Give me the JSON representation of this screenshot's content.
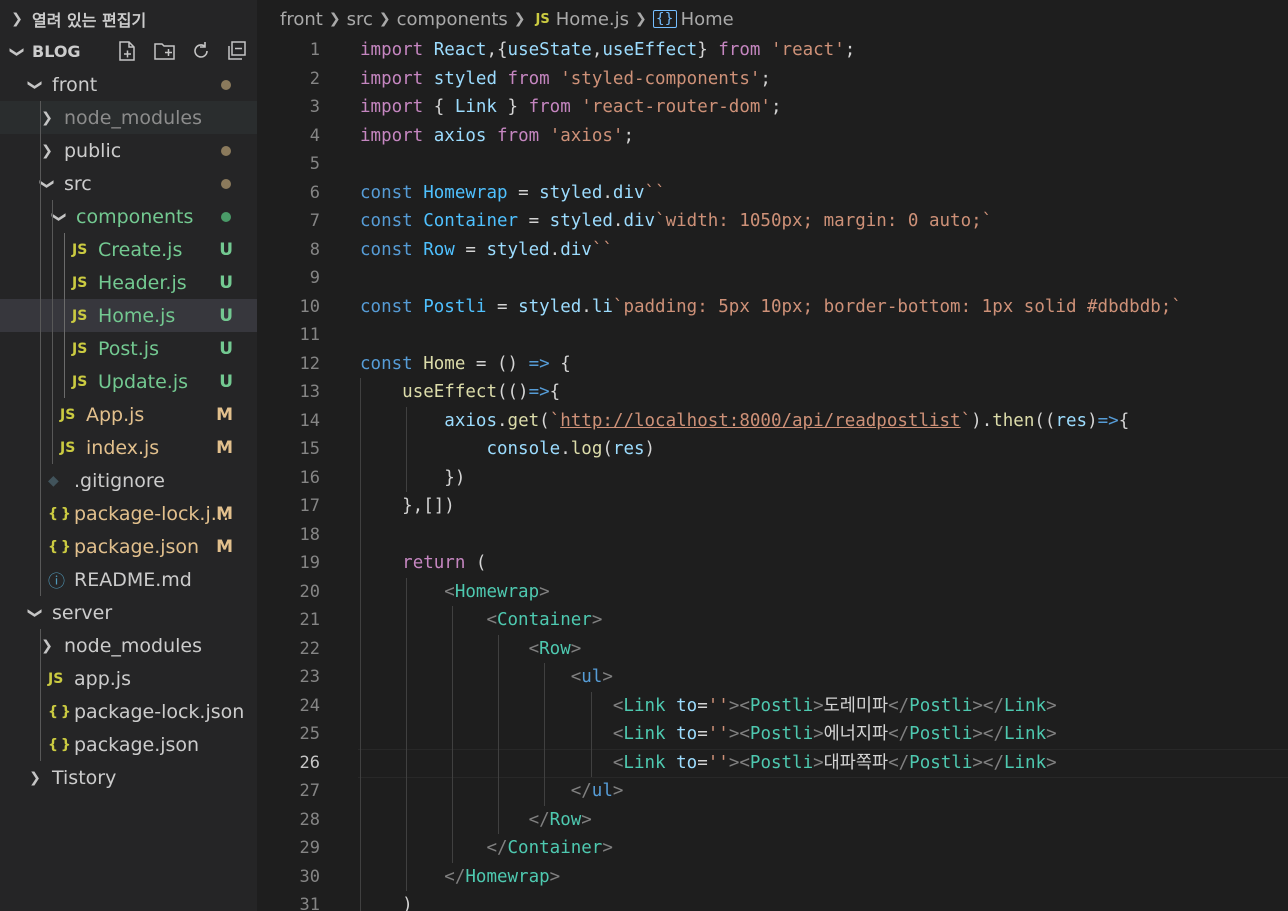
{
  "explorer": {
    "open_editors_label": "열려 있는 편집기",
    "project": "BLOG",
    "toolbar_icons": [
      "new-file-icon",
      "new-folder-icon",
      "refresh-icon",
      "collapse-all-icon"
    ],
    "items": [
      {
        "label": "front",
        "kind": "folder",
        "expanded": true,
        "indent": 1,
        "status": "dot"
      },
      {
        "label": "node_modules",
        "kind": "folder",
        "expanded": false,
        "indent": 2,
        "status": "",
        "dim": true
      },
      {
        "label": "public",
        "kind": "folder",
        "expanded": false,
        "indent": 2,
        "status": "dot"
      },
      {
        "label": "src",
        "kind": "folder",
        "expanded": true,
        "indent": 2,
        "status": "dot"
      },
      {
        "label": "components",
        "kind": "folder",
        "expanded": true,
        "indent": 3,
        "status": "dot-green",
        "color": "green"
      },
      {
        "label": "Create.js",
        "kind": "js",
        "indent": 4,
        "status": "U",
        "color": "green"
      },
      {
        "label": "Header.js",
        "kind": "js",
        "indent": 4,
        "status": "U",
        "color": "green"
      },
      {
        "label": "Home.js",
        "kind": "js",
        "indent": 4,
        "status": "U",
        "color": "green",
        "selected": true
      },
      {
        "label": "Post.js",
        "kind": "js",
        "indent": 4,
        "status": "U",
        "color": "green"
      },
      {
        "label": "Update.js",
        "kind": "js",
        "indent": 4,
        "status": "U",
        "color": "green"
      },
      {
        "label": "App.js",
        "kind": "js",
        "indent": 3,
        "status": "M",
        "color": "yellow"
      },
      {
        "label": "index.js",
        "kind": "js",
        "indent": 3,
        "status": "M",
        "color": "yellow"
      },
      {
        "label": ".gitignore",
        "kind": "git",
        "indent": 2,
        "status": ""
      },
      {
        "label": "package-lock.j...",
        "kind": "json",
        "indent": 2,
        "status": "M",
        "color": "yellow"
      },
      {
        "label": "package.json",
        "kind": "json",
        "indent": 2,
        "status": "M",
        "color": "yellow"
      },
      {
        "label": "README.md",
        "kind": "info",
        "indent": 2,
        "status": ""
      },
      {
        "label": "server",
        "kind": "folder",
        "expanded": true,
        "indent": 1,
        "status": ""
      },
      {
        "label": "node_modules",
        "kind": "folder",
        "expanded": false,
        "indent": 2,
        "status": ""
      },
      {
        "label": "app.js",
        "kind": "js",
        "indent": 2,
        "status": ""
      },
      {
        "label": "package-lock.json",
        "kind": "json",
        "indent": 2,
        "status": ""
      },
      {
        "label": "package.json",
        "kind": "json",
        "indent": 2,
        "status": ""
      },
      {
        "label": "Tistory",
        "kind": "folder",
        "expanded": false,
        "indent": 1,
        "status": ""
      }
    ]
  },
  "breadcrumbs": {
    "parts": [
      "front",
      "src",
      "components"
    ],
    "file_icon": "JS",
    "file": "Home.js",
    "symbol_icon": "{}",
    "symbol": "Home"
  },
  "editor": {
    "active_line": 26,
    "lines": [
      [
        [
          "kw",
          "import"
        ],
        [
          "pu",
          " "
        ],
        [
          "va",
          "React"
        ],
        [
          "pu",
          ","
        ],
        [
          "pu",
          "{"
        ],
        [
          "va",
          "useState"
        ],
        [
          "pu",
          ","
        ],
        [
          "va",
          "useEffect"
        ],
        [
          "pu",
          "} "
        ],
        [
          "kw",
          "from"
        ],
        [
          "pu",
          " "
        ],
        [
          "st",
          "'react'"
        ],
        [
          "pu",
          ";"
        ]
      ],
      [
        [
          "kw",
          "import"
        ],
        [
          "pu",
          " "
        ],
        [
          "va",
          "styled"
        ],
        [
          "pu",
          " "
        ],
        [
          "kw",
          "from"
        ],
        [
          "pu",
          " "
        ],
        [
          "st",
          "'styled-components'"
        ],
        [
          "pu",
          ";"
        ]
      ],
      [
        [
          "kw",
          "import"
        ],
        [
          "pu",
          " { "
        ],
        [
          "va",
          "Link"
        ],
        [
          "pu",
          " } "
        ],
        [
          "kw",
          "from"
        ],
        [
          "pu",
          " "
        ],
        [
          "st",
          "'react-router-dom'"
        ],
        [
          "pu",
          ";"
        ]
      ],
      [
        [
          "kw",
          "import"
        ],
        [
          "pu",
          " "
        ],
        [
          "va",
          "axios"
        ],
        [
          "pu",
          " "
        ],
        [
          "kw",
          "from"
        ],
        [
          "pu",
          " "
        ],
        [
          "st",
          "'axios'"
        ],
        [
          "pu",
          ";"
        ]
      ],
      [],
      [
        [
          "kb",
          "const"
        ],
        [
          "pu",
          " "
        ],
        [
          "co",
          "Homewrap"
        ],
        [
          "pu",
          " = "
        ],
        [
          "va",
          "styled"
        ],
        [
          "pu",
          "."
        ],
        [
          "va",
          "div"
        ],
        [
          "st",
          "``"
        ]
      ],
      [
        [
          "kb",
          "const"
        ],
        [
          "pu",
          " "
        ],
        [
          "co",
          "Container"
        ],
        [
          "pu",
          " = "
        ],
        [
          "va",
          "styled"
        ],
        [
          "pu",
          "."
        ],
        [
          "va",
          "div"
        ],
        [
          "st",
          "`width: 1050px; margin: 0 auto;`"
        ]
      ],
      [
        [
          "kb",
          "const"
        ],
        [
          "pu",
          " "
        ],
        [
          "co",
          "Row"
        ],
        [
          "pu",
          " = "
        ],
        [
          "va",
          "styled"
        ],
        [
          "pu",
          "."
        ],
        [
          "va",
          "div"
        ],
        [
          "st",
          "``"
        ]
      ],
      [],
      [
        [
          "kb",
          "const"
        ],
        [
          "pu",
          " "
        ],
        [
          "co",
          "Postli"
        ],
        [
          "pu",
          " = "
        ],
        [
          "va",
          "styled"
        ],
        [
          "pu",
          "."
        ],
        [
          "va",
          "li"
        ],
        [
          "st",
          "`padding: 5px 10px; border-bottom: 1px solid #dbdbdb;`"
        ]
      ],
      [],
      [
        [
          "kb",
          "const"
        ],
        [
          "pu",
          " "
        ],
        [
          "fn",
          "Home"
        ],
        [
          "pu",
          " = () "
        ],
        [
          "kb",
          "=>"
        ],
        [
          "pu",
          " {"
        ]
      ],
      [
        [
          "pu",
          "    "
        ],
        [
          "fn",
          "useEffect"
        ],
        [
          "pu",
          "(()"
        ],
        [
          "kb",
          "=>"
        ],
        [
          "pu",
          "{"
        ]
      ],
      [
        [
          "pu",
          "        "
        ],
        [
          "va",
          "axios"
        ],
        [
          "pu",
          "."
        ],
        [
          "fn",
          "get"
        ],
        [
          "pu",
          "("
        ],
        [
          "st",
          "`"
        ],
        [
          "ur",
          "http://localhost:8000/api/readpostlist"
        ],
        [
          "st",
          "`"
        ],
        [
          "pu",
          ")."
        ],
        [
          "fn",
          "then"
        ],
        [
          "pu",
          "(("
        ],
        [
          "va",
          "res"
        ],
        [
          "pu",
          ")"
        ],
        [
          "kb",
          "=>"
        ],
        [
          "pu",
          "{"
        ]
      ],
      [
        [
          "pu",
          "            "
        ],
        [
          "va",
          "console"
        ],
        [
          "pu",
          "."
        ],
        [
          "fn",
          "log"
        ],
        [
          "pu",
          "("
        ],
        [
          "va",
          "res"
        ],
        [
          "pu",
          ")"
        ]
      ],
      [
        [
          "pu",
          "        })"
        ]
      ],
      [
        [
          "pu",
          "    },[])"
        ]
      ],
      [],
      [
        [
          "pu",
          "    "
        ],
        [
          "kw",
          "return"
        ],
        [
          "pu",
          " ("
        ]
      ],
      [
        [
          "pu",
          "        "
        ],
        [
          "tg",
          "<"
        ],
        [
          "ty",
          "Homewrap"
        ],
        [
          "tg",
          ">"
        ]
      ],
      [
        [
          "pu",
          "            "
        ],
        [
          "tg",
          "<"
        ],
        [
          "ty",
          "Container"
        ],
        [
          "tg",
          ">"
        ]
      ],
      [
        [
          "pu",
          "                "
        ],
        [
          "tg",
          "<"
        ],
        [
          "ty",
          "Row"
        ],
        [
          "tg",
          ">"
        ]
      ],
      [
        [
          "pu",
          "                    "
        ],
        [
          "tg",
          "<"
        ],
        [
          "kb",
          "ul"
        ],
        [
          "tg",
          ">"
        ]
      ],
      [
        [
          "pu",
          "                        "
        ],
        [
          "tg",
          "<"
        ],
        [
          "ty",
          "Link"
        ],
        [
          "pu",
          " "
        ],
        [
          "va",
          "to"
        ],
        [
          "pu",
          "="
        ],
        [
          "st",
          "''"
        ],
        [
          "tg",
          "><"
        ],
        [
          "ty",
          "Postli"
        ],
        [
          "tg",
          ">"
        ],
        [
          "pu",
          "도레미파"
        ],
        [
          "tg",
          "</"
        ],
        [
          "ty",
          "Postli"
        ],
        [
          "tg",
          "></"
        ],
        [
          "ty",
          "Link"
        ],
        [
          "tg",
          ">"
        ]
      ],
      [
        [
          "pu",
          "                        "
        ],
        [
          "tg",
          "<"
        ],
        [
          "ty",
          "Link"
        ],
        [
          "pu",
          " "
        ],
        [
          "va",
          "to"
        ],
        [
          "pu",
          "="
        ],
        [
          "st",
          "''"
        ],
        [
          "tg",
          "><"
        ],
        [
          "ty",
          "Postli"
        ],
        [
          "tg",
          ">"
        ],
        [
          "pu",
          "에너지파"
        ],
        [
          "tg",
          "</"
        ],
        [
          "ty",
          "Postli"
        ],
        [
          "tg",
          "></"
        ],
        [
          "ty",
          "Link"
        ],
        [
          "tg",
          ">"
        ]
      ],
      [
        [
          "pu",
          "                        "
        ],
        [
          "tg",
          "<"
        ],
        [
          "ty",
          "Link"
        ],
        [
          "pu",
          " "
        ],
        [
          "va",
          "to"
        ],
        [
          "pu",
          "="
        ],
        [
          "st",
          "''"
        ],
        [
          "tg",
          "><"
        ],
        [
          "ty",
          "Postli"
        ],
        [
          "tg",
          ">"
        ],
        [
          "pu",
          "대파쪽파"
        ],
        [
          "tg",
          "</"
        ],
        [
          "ty",
          "Postli"
        ],
        [
          "tg",
          "></"
        ],
        [
          "ty",
          "Link"
        ],
        [
          "tg",
          ">"
        ]
      ],
      [
        [
          "pu",
          "                    "
        ],
        [
          "tg",
          "</"
        ],
        [
          "kb",
          "ul"
        ],
        [
          "tg",
          ">"
        ]
      ],
      [
        [
          "pu",
          "                "
        ],
        [
          "tg",
          "</"
        ],
        [
          "ty",
          "Row"
        ],
        [
          "tg",
          ">"
        ]
      ],
      [
        [
          "pu",
          "            "
        ],
        [
          "tg",
          "</"
        ],
        [
          "ty",
          "Container"
        ],
        [
          "tg",
          ">"
        ]
      ],
      [
        [
          "pu",
          "        "
        ],
        [
          "tg",
          "</"
        ],
        [
          "ty",
          "Homewrap"
        ],
        [
          "tg",
          ">"
        ]
      ],
      [
        [
          "pu",
          "    )"
        ]
      ]
    ]
  }
}
